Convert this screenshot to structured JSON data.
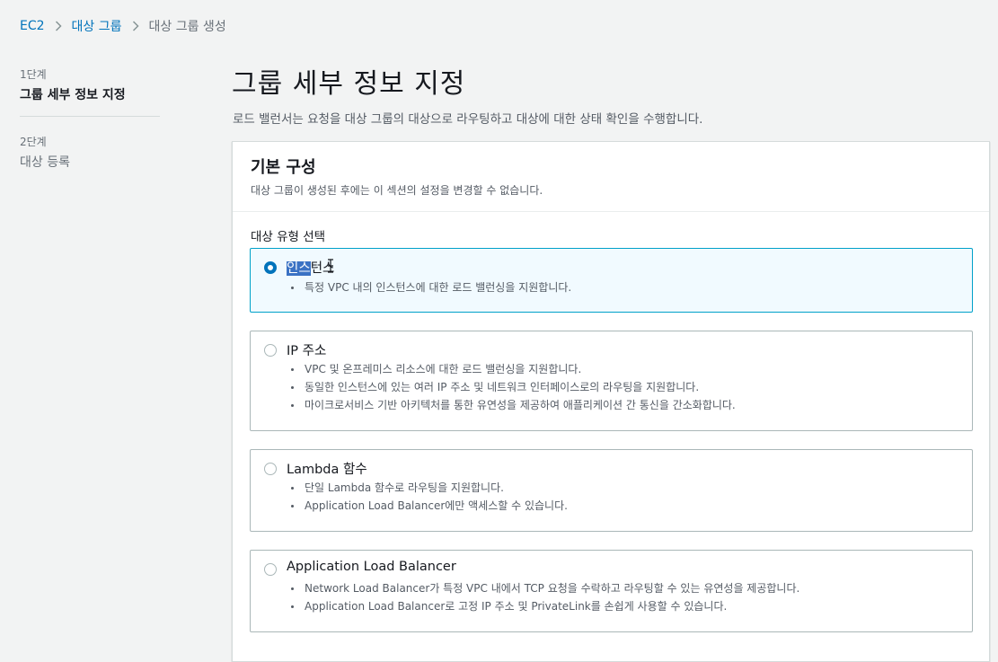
{
  "breadcrumb": {
    "items": [
      {
        "label": "EC2",
        "link": true
      },
      {
        "label": "대상 그룹",
        "link": true
      },
      {
        "label": "대상 그룹 생성",
        "link": false
      }
    ]
  },
  "steps": [
    {
      "num": "1단계",
      "title": "그룹 세부 정보 지정",
      "active": true
    },
    {
      "num": "2단계",
      "title": "대상 등록",
      "active": false
    }
  ],
  "page": {
    "title": "그룹 세부 정보 지정",
    "description": "로드 밸런서는 요청을 대상 그룹의 대상으로 라우팅하고 대상에 대한 상태 확인을 수행합니다."
  },
  "panel": {
    "title": "기본 구성",
    "subtitle": "대상 그룹이 생성된 후에는 이 섹션의 설정을 변경할 수 없습니다.",
    "field_label": "대상 유형 선택",
    "options": [
      {
        "title_highlight": "인스",
        "title_rest": "턴스",
        "selected": true,
        "bullets": [
          "특정 VPC 내의 인스턴스에 대한 로드 밸런싱을 지원합니다."
        ]
      },
      {
        "title": "IP 주소",
        "selected": false,
        "bullets": [
          "VPC 및 온프레미스 리소스에 대한 로드 밸런싱을 지원합니다.",
          "동일한 인스턴스에 있는 여러 IP 주소 및 네트워크 인터페이스로의 라우팅을 지원합니다.",
          "마이크로서비스 기반 아키텍처를 통한 유연성을 제공하여 애플리케이션 간 통신을 간소화합니다."
        ]
      },
      {
        "title": "Lambda 함수",
        "selected": false,
        "bullets": [
          "단일 Lambda 함수로 라우팅을 지원합니다.",
          "Application Load Balancer에만 액세스할 수 있습니다."
        ]
      },
      {
        "title": "Application Load Balancer",
        "selected": false,
        "bullets": [
          "Network Load Balancer가 특정 VPC 내에서 TCP 요청을 수락하고 라우팅할 수 있는 유연성을 제공합니다.",
          "Application Load Balancer로 고정 IP 주소 및 PrivateLink를 손쉽게 사용할 수 있습니다."
        ]
      }
    ]
  },
  "colors": {
    "link": "#0073bb",
    "selected_border": "#00a1c9",
    "selected_bg": "#f1faff",
    "text_highlight": "#3b72c4"
  }
}
